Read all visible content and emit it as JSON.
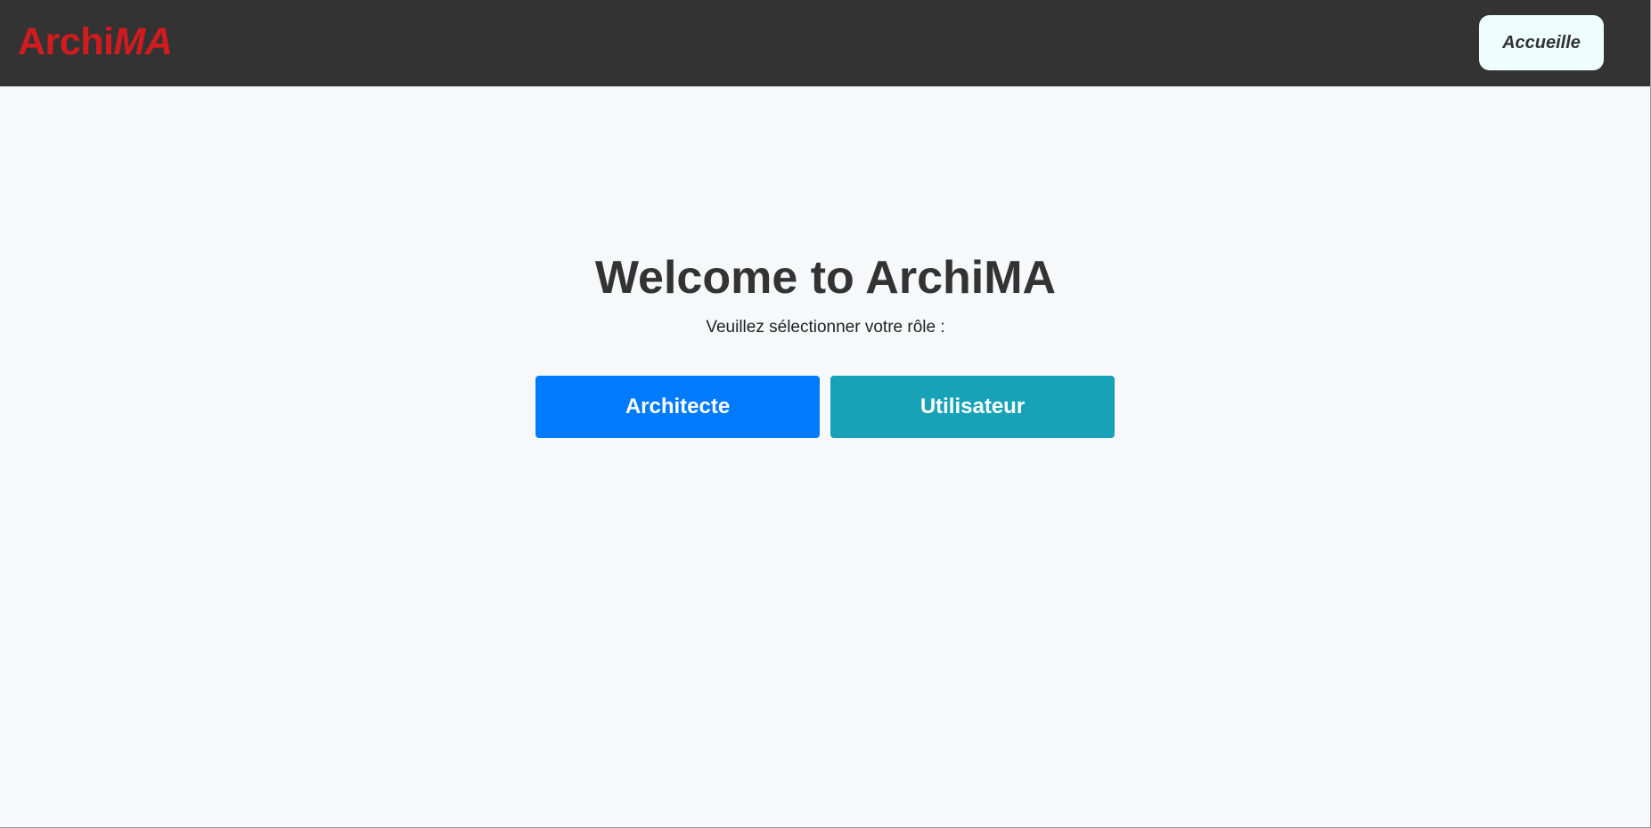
{
  "header": {
    "logo_regular": "Archi",
    "logo_italic": "MA",
    "home_label": "Accueille"
  },
  "main": {
    "title": "Welcome to ArchiMA",
    "subtitle": "Veuillez sélectionner votre rôle :",
    "roles": [
      {
        "label": "Architecte",
        "color": "#007bff"
      },
      {
        "label": "Utilisateur",
        "color": "#17a2b8"
      }
    ]
  },
  "colors": {
    "header_bg": "#333333",
    "logo": "#d01c1f",
    "page_bg": "#f7f8fa",
    "home_button_bg": "#eefdfd",
    "text": "#333333"
  }
}
